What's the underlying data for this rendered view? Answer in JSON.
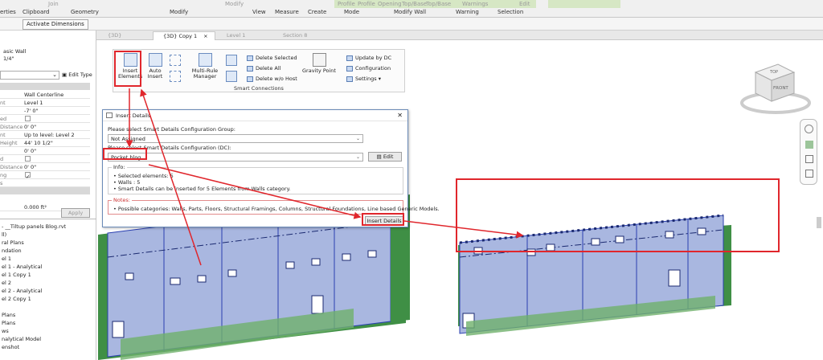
{
  "ribbon": {
    "groups": [
      "erties",
      "Clipboard",
      "Geometry",
      "Modify",
      "View",
      "Measure",
      "Create",
      "Mode",
      "Modify Wall",
      "Warning",
      "Selection"
    ],
    "top_items": [
      "Join",
      "Modify",
      "Profile",
      "Profile",
      "Opening",
      "Top/Base",
      "Top/Base",
      "Warnings",
      "Edit"
    ]
  },
  "context": {
    "activate_dimensions": "Activate Dimensions"
  },
  "properties": {
    "type_line1": "asic Wall",
    "type_line2": "1/4\"",
    "edit_type": "Edit Type",
    "rows": [
      {
        "name": "",
        "value": "Wall Centerline"
      },
      {
        "name": "nt",
        "value": "Level 1"
      },
      {
        "name": "",
        "value": "-7' 0\""
      },
      {
        "name": "ed",
        "value": ""
      },
      {
        "name": "Distance",
        "value": "0' 0\""
      },
      {
        "name": "nt",
        "value": "Up to level: Level 2"
      },
      {
        "name": "Height",
        "value": "44' 10 1/2\""
      },
      {
        "name": "",
        "value": "0' 0\""
      },
      {
        "name": "d",
        "value": ""
      },
      {
        "name": "Distance",
        "value": "0' 0\""
      },
      {
        "name": "ng",
        "value": ""
      },
      {
        "name": "s",
        "value": ""
      }
    ],
    "row_last": "0.000 ft²",
    "apply": "Apply"
  },
  "project_browser": {
    "root": "- __Tiltup panels Blog.rvt",
    "items": [
      "ll)",
      "ral Plans",
      "ndation",
      "el 1",
      "el 1 - Analytical",
      "el 1 Copy 1",
      "el 2",
      "el 2 - Analytical",
      "el 2 Copy 1",
      "",
      "Plans",
      "Plans",
      "ws",
      "nalytical Model",
      "enshot"
    ]
  },
  "view_tabs": [
    {
      "label": "{3D}",
      "active": false
    },
    {
      "label": "{3D} Copy 1",
      "active": true
    },
    {
      "label": "Level 1",
      "active": false
    },
    {
      "label": "Section 8",
      "active": false
    }
  ],
  "smart_panel": {
    "insert_elements": "Insert Elements",
    "auto_insert": "Auto Insert",
    "multi_rule_manager": "Multi-Rule Manager",
    "delete_selected": "Delete Selected",
    "delete_all": "Delete All",
    "delete_wo_host": "Delete w/o Host",
    "gravity_point": "Gravity Point",
    "update_by_dc": "Update by DC",
    "configuration": "Configuration",
    "settings": "Settings",
    "footer": "Smart Connections"
  },
  "dialog": {
    "title": "Insert Details",
    "group_label": "Please select Smart Details Configuration Group:",
    "group_value": "Not Assigned",
    "dc_label": "Please select Smart Details Configuration (DC):",
    "dc_value": "Pocket blog",
    "edit": "Edit",
    "info_legend": "Info:",
    "info_lines": [
      "• Selected elements:  5",
      "• Walls  :  5",
      "• Smart Details can be inserted for 5 Elements from Walls category."
    ],
    "notes_legend": "Notes:",
    "notes_line": "• Possible categories: Walls, Parts, Floors, Structural Framings, Columns, Structural Foundations, Line based Generic Models.",
    "insert_details": "Insert Details",
    "close": "✕"
  },
  "viewcube": {
    "top": "TOP",
    "front": "FRONT"
  },
  "colors": {
    "wall_fill": "#a9b7e0",
    "wall_stroke": "#2a3fb0",
    "green": "#3f8f45",
    "annotation_red": "#e0262c"
  }
}
